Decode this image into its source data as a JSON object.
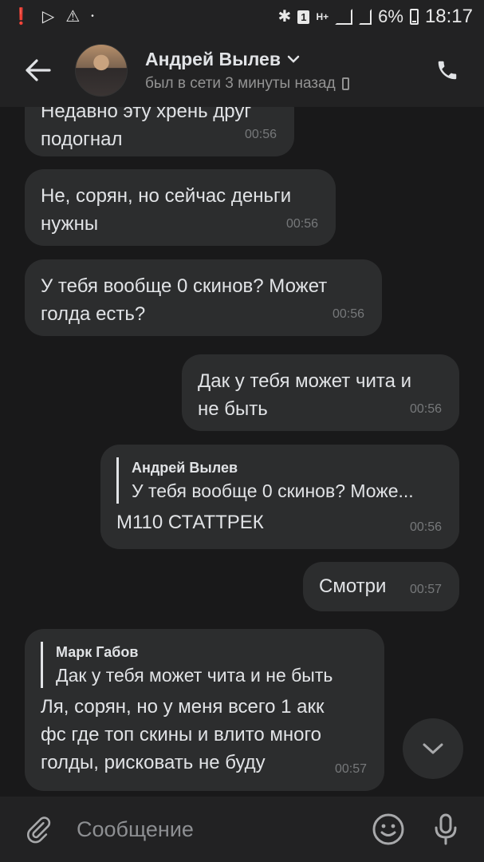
{
  "status_bar": {
    "battery": "6%",
    "time": "18:17",
    "sim_badge": "1",
    "network": "H+"
  },
  "header": {
    "name": "Андрей Вылев",
    "status": "был в сети 3 минуты назад"
  },
  "messages": [
    {
      "lines": [
        "Недавно эту хрень друг",
        "подогнал"
      ],
      "time": "00:56",
      "side": "in"
    },
    {
      "lines": [
        "Не, сорян, но сейчас деньги",
        "нужны"
      ],
      "time": "00:56",
      "side": "in"
    },
    {
      "lines": [
        "У тебя вообще 0 скинов? Может",
        "голда есть?"
      ],
      "time": "00:56",
      "side": "in"
    },
    {
      "lines": [
        "Дак у тебя может чита и",
        "не быть"
      ],
      "time": "00:56",
      "side": "out"
    },
    {
      "reply_author": "Андрей Вылев",
      "reply_text": "У тебя вообще 0 скинов? Може...",
      "lines": [
        "М110 СТАТТРЕК"
      ],
      "time": "00:56",
      "side": "out"
    },
    {
      "lines": [
        "Смотри"
      ],
      "time": "00:57",
      "side": "out"
    },
    {
      "reply_author": "Марк Габов",
      "reply_text": "Дак у тебя может чита и не быть",
      "lines": [
        "Ля, сорян, но у меня всего 1 акк",
        "фс где топ скины и влито много",
        "голды, рисковать не буду"
      ],
      "time": "00:57",
      "side": "in"
    }
  ],
  "composer": {
    "placeholder": "Сообщение"
  },
  "icons": {
    "back": "arrow-left-icon",
    "call": "phone-call-icon",
    "attach": "paperclip-icon",
    "emoji": "smile-icon",
    "mic": "microphone-icon",
    "scroll": "chevron-down-icon"
  },
  "colors": {
    "background": "#19191a",
    "bar": "#222223",
    "bubble": "#2c2d2e",
    "text": "#e1e3e6",
    "muted": "#76787a"
  }
}
